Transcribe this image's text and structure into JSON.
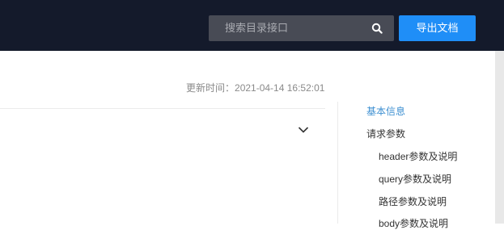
{
  "header": {
    "search": {
      "placeholder": "搜索目录接口"
    },
    "export_label": "导出文档"
  },
  "doc": {
    "updated_label": "更新时间：",
    "updated_time": "2021-04-14 16:52:01"
  },
  "toc": {
    "items": [
      {
        "label": "基本信息"
      },
      {
        "label": "请求参数"
      },
      {
        "label": "header参数及说明"
      },
      {
        "label": "query参数及说明"
      },
      {
        "label": "路径参数及说明"
      },
      {
        "label": "body参数及说明"
      }
    ]
  },
  "colors": {
    "topbar": "#141a2b",
    "accent": "#1f8ef7",
    "toc_active": "#3d8fd1"
  }
}
